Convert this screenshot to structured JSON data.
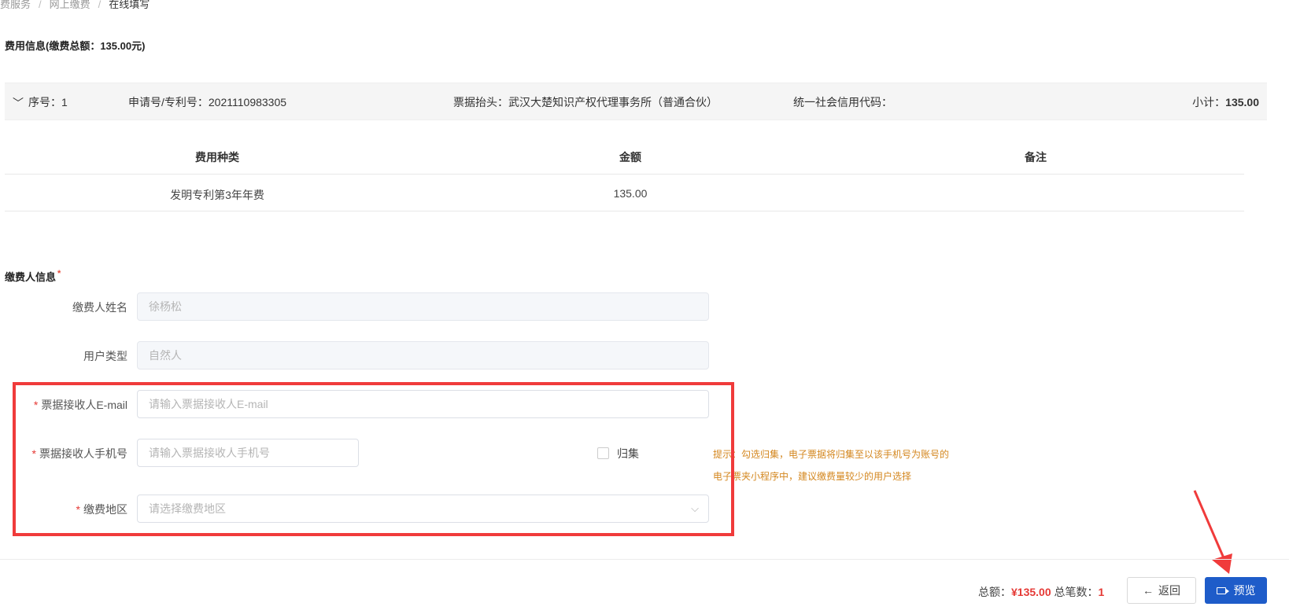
{
  "breadcrumb": {
    "items": [
      "费服务",
      "网上缴费",
      "在线填写"
    ]
  },
  "fee_info": {
    "title": "费用信息(缴费总额：135.00元)",
    "summary": {
      "chevron_icon": "chevron-down-icon",
      "seq_label": "序号：1",
      "application_label": "申请号/专利号：2021110983305",
      "invoice_header_label": "票据抬头：武汉大楚知识产权代理事务所（普通合伙）",
      "credit_code_label": "统一社会信用代码：",
      "subtotal_label": "小计：",
      "subtotal_value": "135.00"
    },
    "table": {
      "headers": [
        "费用种类",
        "金额",
        "备注"
      ],
      "rows": [
        [
          "发明专利第3年年费",
          "135.00",
          ""
        ]
      ]
    }
  },
  "payer_info": {
    "title": "缴费人信息",
    "required_mark": "*",
    "fields": {
      "name": {
        "label": "缴费人姓名",
        "value": "徐杨松"
      },
      "user_type": {
        "label": "用户类型",
        "value": "自然人"
      },
      "email": {
        "required": "*",
        "label": "票据接收人E-mail",
        "placeholder": "请输入票据接收人E-mail"
      },
      "phone": {
        "required": "*",
        "label": "票据接收人手机号",
        "placeholder": "请输入票据接收人手机号"
      },
      "region": {
        "required": "*",
        "label": "缴费地区",
        "placeholder": "请选择缴费地区",
        "arrow": "⌵"
      }
    },
    "collect": {
      "label": "归集",
      "hint_line1": "提示：勾选归集，电子票据将归集至以该手机号为账号的",
      "hint_line2": "电子票夹小程序中，建议缴费量较少的用户选择"
    }
  },
  "footer": {
    "total_label": "总额：",
    "total_value": "¥135.00",
    "count_label": "总笔数：",
    "count_value": "1",
    "back_label": "返回",
    "back_icon": "←",
    "preview_label": "预览"
  },
  "colors": {
    "accent": "#1e5cc9",
    "highlight": "#f03b3b",
    "amount_red": "#e53935",
    "hint": "#d4871f"
  }
}
